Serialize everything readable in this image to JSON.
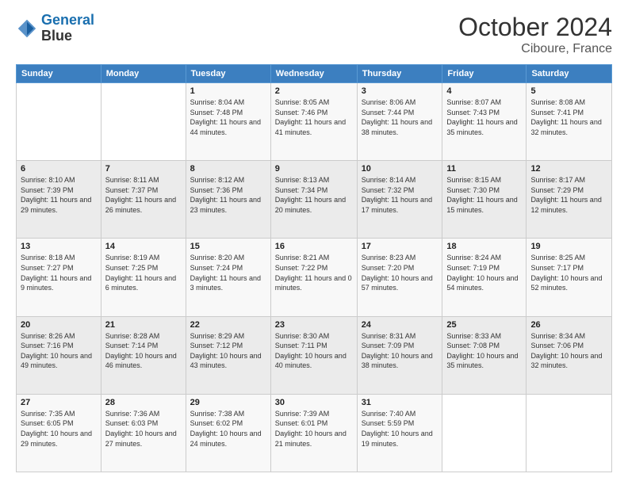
{
  "header": {
    "logo_line1": "General",
    "logo_line2": "Blue",
    "month": "October 2024",
    "location": "Ciboure, France"
  },
  "weekdays": [
    "Sunday",
    "Monday",
    "Tuesday",
    "Wednesday",
    "Thursday",
    "Friday",
    "Saturday"
  ],
  "weeks": [
    [
      {
        "day": "",
        "info": ""
      },
      {
        "day": "",
        "info": ""
      },
      {
        "day": "1",
        "info": "Sunrise: 8:04 AM\nSunset: 7:48 PM\nDaylight: 11 hours and 44 minutes."
      },
      {
        "day": "2",
        "info": "Sunrise: 8:05 AM\nSunset: 7:46 PM\nDaylight: 11 hours and 41 minutes."
      },
      {
        "day": "3",
        "info": "Sunrise: 8:06 AM\nSunset: 7:44 PM\nDaylight: 11 hours and 38 minutes."
      },
      {
        "day": "4",
        "info": "Sunrise: 8:07 AM\nSunset: 7:43 PM\nDaylight: 11 hours and 35 minutes."
      },
      {
        "day": "5",
        "info": "Sunrise: 8:08 AM\nSunset: 7:41 PM\nDaylight: 11 hours and 32 minutes."
      }
    ],
    [
      {
        "day": "6",
        "info": "Sunrise: 8:10 AM\nSunset: 7:39 PM\nDaylight: 11 hours and 29 minutes."
      },
      {
        "day": "7",
        "info": "Sunrise: 8:11 AM\nSunset: 7:37 PM\nDaylight: 11 hours and 26 minutes."
      },
      {
        "day": "8",
        "info": "Sunrise: 8:12 AM\nSunset: 7:36 PM\nDaylight: 11 hours and 23 minutes."
      },
      {
        "day": "9",
        "info": "Sunrise: 8:13 AM\nSunset: 7:34 PM\nDaylight: 11 hours and 20 minutes."
      },
      {
        "day": "10",
        "info": "Sunrise: 8:14 AM\nSunset: 7:32 PM\nDaylight: 11 hours and 17 minutes."
      },
      {
        "day": "11",
        "info": "Sunrise: 8:15 AM\nSunset: 7:30 PM\nDaylight: 11 hours and 15 minutes."
      },
      {
        "day": "12",
        "info": "Sunrise: 8:17 AM\nSunset: 7:29 PM\nDaylight: 11 hours and 12 minutes."
      }
    ],
    [
      {
        "day": "13",
        "info": "Sunrise: 8:18 AM\nSunset: 7:27 PM\nDaylight: 11 hours and 9 minutes."
      },
      {
        "day": "14",
        "info": "Sunrise: 8:19 AM\nSunset: 7:25 PM\nDaylight: 11 hours and 6 minutes."
      },
      {
        "day": "15",
        "info": "Sunrise: 8:20 AM\nSunset: 7:24 PM\nDaylight: 11 hours and 3 minutes."
      },
      {
        "day": "16",
        "info": "Sunrise: 8:21 AM\nSunset: 7:22 PM\nDaylight: 11 hours and 0 minutes."
      },
      {
        "day": "17",
        "info": "Sunrise: 8:23 AM\nSunset: 7:20 PM\nDaylight: 10 hours and 57 minutes."
      },
      {
        "day": "18",
        "info": "Sunrise: 8:24 AM\nSunset: 7:19 PM\nDaylight: 10 hours and 54 minutes."
      },
      {
        "day": "19",
        "info": "Sunrise: 8:25 AM\nSunset: 7:17 PM\nDaylight: 10 hours and 52 minutes."
      }
    ],
    [
      {
        "day": "20",
        "info": "Sunrise: 8:26 AM\nSunset: 7:16 PM\nDaylight: 10 hours and 49 minutes."
      },
      {
        "day": "21",
        "info": "Sunrise: 8:28 AM\nSunset: 7:14 PM\nDaylight: 10 hours and 46 minutes."
      },
      {
        "day": "22",
        "info": "Sunrise: 8:29 AM\nSunset: 7:12 PM\nDaylight: 10 hours and 43 minutes."
      },
      {
        "day": "23",
        "info": "Sunrise: 8:30 AM\nSunset: 7:11 PM\nDaylight: 10 hours and 40 minutes."
      },
      {
        "day": "24",
        "info": "Sunrise: 8:31 AM\nSunset: 7:09 PM\nDaylight: 10 hours and 38 minutes."
      },
      {
        "day": "25",
        "info": "Sunrise: 8:33 AM\nSunset: 7:08 PM\nDaylight: 10 hours and 35 minutes."
      },
      {
        "day": "26",
        "info": "Sunrise: 8:34 AM\nSunset: 7:06 PM\nDaylight: 10 hours and 32 minutes."
      }
    ],
    [
      {
        "day": "27",
        "info": "Sunrise: 7:35 AM\nSunset: 6:05 PM\nDaylight: 10 hours and 29 minutes."
      },
      {
        "day": "28",
        "info": "Sunrise: 7:36 AM\nSunset: 6:03 PM\nDaylight: 10 hours and 27 minutes."
      },
      {
        "day": "29",
        "info": "Sunrise: 7:38 AM\nSunset: 6:02 PM\nDaylight: 10 hours and 24 minutes."
      },
      {
        "day": "30",
        "info": "Sunrise: 7:39 AM\nSunset: 6:01 PM\nDaylight: 10 hours and 21 minutes."
      },
      {
        "day": "31",
        "info": "Sunrise: 7:40 AM\nSunset: 5:59 PM\nDaylight: 10 hours and 19 minutes."
      },
      {
        "day": "",
        "info": ""
      },
      {
        "day": "",
        "info": ""
      }
    ]
  ]
}
